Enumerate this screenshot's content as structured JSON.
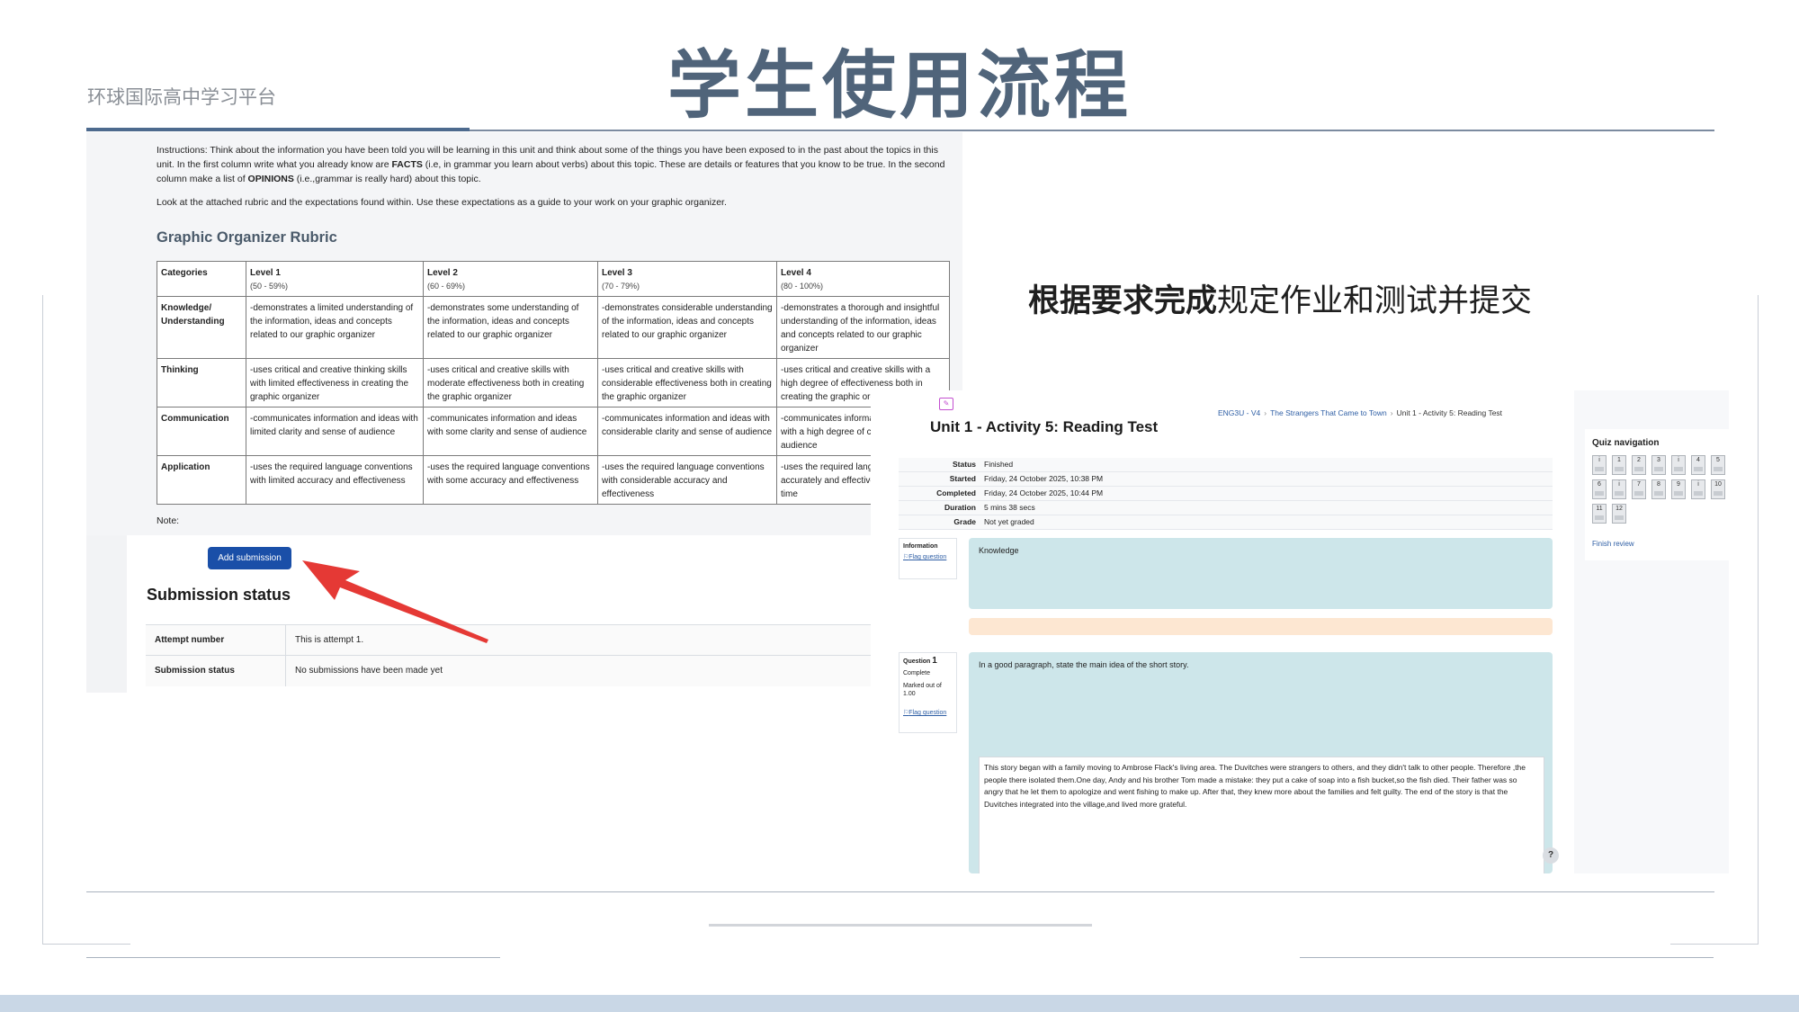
{
  "slide": {
    "title": "学生使用流程",
    "brand": "环球国际高中学习平台",
    "caption_bold": "根据要求完成",
    "caption_rest": "规定作业和测试并提交"
  },
  "assignment": {
    "instructions_p1": "Instructions: Think about the information you have been told you will be learning in this unit and think about some of the things you have been exposed to in the past about the topics in this unit. In the first column write what you already know are FACTS (i.e, in grammar you learn about verbs) about this topic. These are details or features that you know to be true. In the second column make a list of OPINIONS (i.e.,grammar is really hard) about this topic.",
    "instructions_p2": "Look at the attached rubric and the expectations found within.  Use these expectations as a guide to your work on your graphic organizer.",
    "rubric_title": "Graphic Organizer Rubric",
    "rubric": {
      "headers": [
        {
          "label": "Categories",
          "range": ""
        },
        {
          "label": "Level 1",
          "range": "(50 - 59%)"
        },
        {
          "label": "Level 2",
          "range": "(60 - 69%)"
        },
        {
          "label": "Level 3",
          "range": "(70 - 79%)"
        },
        {
          "label": "Level 4",
          "range": "(80 - 100%)"
        }
      ],
      "rows": [
        {
          "category": "Knowledge/ Understanding",
          "cells": [
            "-demonstrates a limited understanding of the information, ideas and concepts related to our graphic organizer",
            "-demonstrates some understanding of the information, ideas and concepts related to our graphic organizer",
            "-demonstrates considerable understanding of the information, ideas and concepts related to our graphic organizer",
            "-demonstrates a thorough and insightful understanding of the information, ideas and concepts related to our graphic organizer"
          ]
        },
        {
          "category": "Thinking",
          "cells": [
            "-uses critical and creative thinking skills with limited effectiveness in creating the graphic organizer",
            "-uses critical and creative skills with moderate effectiveness both in creating the graphic organizer",
            "-uses critical and creative skills with considerable effectiveness both in creating the graphic organizer",
            "-uses critical and creative skills with a high degree of effectiveness both in creating the graphic organizer"
          ]
        },
        {
          "category": "Communication",
          "cells": [
            "-communicates information and ideas with limited clarity and sense of audience",
            "-communicates information and ideas with some clarity and sense of audience",
            "-communicates information and ideas with considerable clarity and sense of audience",
            "-communicates information and ideas with a high degree of clarity and sense of audience"
          ]
        },
        {
          "category": "Application",
          "cells": [
            "-uses the required language conventions with limited accuracy and effectiveness",
            "-uses the required language conventions with some accuracy and effectiveness",
            "-uses the required language conventions with considerable accuracy and effectiveness",
            "-uses the required language conventions accurately and effectively most of the time"
          ]
        }
      ]
    },
    "note_label": "Note:",
    "add_submission_label": "Add submission",
    "submission_status_title": "Submission status",
    "status_rows": [
      {
        "key": "Attempt number",
        "value": "This is attempt 1."
      },
      {
        "key": "Submission status",
        "value": "No submissions have been made yet"
      }
    ]
  },
  "quiz": {
    "icon": "quiz-icon",
    "title": "Unit 1 - Activity 5: Reading Test",
    "breadcrumbs": [
      "ENG3U - V4",
      "The Strangers That Came to Town",
      "Unit 1 - Activity 5: Reading Test"
    ],
    "summary": [
      {
        "key": "Status",
        "value": "Finished"
      },
      {
        "key": "Started",
        "value": "Friday, 24 October 2025, 10:38 PM"
      },
      {
        "key": "Completed",
        "value": "Friday, 24 October 2025, 10:44 PM"
      },
      {
        "key": "Duration",
        "value": "5 mins 38 secs"
      },
      {
        "key": "Grade",
        "value": "Not yet graded"
      }
    ],
    "info_block": {
      "label": "Information",
      "flag": "Flag question",
      "content": "Knowledge"
    },
    "question1": {
      "label": "Question",
      "number": "1",
      "state": "Complete",
      "marks": "Marked out of 1.00",
      "flag": "Flag question",
      "prompt": "In a good paragraph, state the main idea of the short story.",
      "answer": "This story began with a family moving to Ambrose Flack's living area.  The Duvitches were strangers to others, and they didn't talk to other people. Therefore ,the people there isolated them.One day, Andy and his brother Tom made a mistake: they put a cake of soap into a fish bucket,so the fish died. Their father was so angry that he let them to apologize and went fishing to make up. After that, they knew more about the families and felt guilty. The end of the story is that the Duvitches integrated into the village,and lived more grateful."
    },
    "help_label": "?",
    "nav": {
      "title": "Quiz navigation",
      "items": [
        "i",
        "1",
        "2",
        "3",
        "i",
        "4",
        "5",
        "6",
        "i",
        "7",
        "8",
        "9",
        "i",
        "10",
        "11",
        "12"
      ],
      "finish_review": "Finish review"
    }
  },
  "colors": {
    "accent_blue": "#1a4fa8",
    "arrow_red": "#e53935",
    "title_gray": "#50647a",
    "answer_bg": "#cde6ea"
  }
}
